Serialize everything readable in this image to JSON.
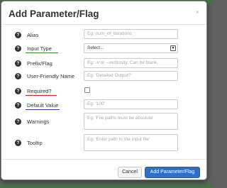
{
  "dialog": {
    "title": "Add Parameter/Flag",
    "close_glyph": "×",
    "help_glyph": "?",
    "fields": {
      "alias": {
        "label": "Alias",
        "placeholder": "Eg: num_of_iterations"
      },
      "input_type": {
        "label": "Input Type",
        "value": "Select...",
        "highlight_color": "#2e8b2e"
      },
      "prefix_flag": {
        "label": "Prefix/Flag",
        "placeholder": "Eg: -v or --verbosity. Can be blank."
      },
      "user_friendly_name": {
        "label": "User-Friendly Name",
        "placeholder": "Eg: 'Detailed Output?'"
      },
      "required": {
        "label": "Required?",
        "checked": false,
        "highlight_color": "#cc2222"
      },
      "default_value": {
        "label": "Default Value",
        "placeholder": "Eg: '100'",
        "highlight_color": "#3535b0"
      },
      "warnings": {
        "label": "Warnings",
        "placeholder": "Eg: 'File paths must be absolute'"
      },
      "tooltip": {
        "label": "Tooltip",
        "placeholder": "Eg: 'Enter path to the input file'"
      }
    },
    "footer": {
      "cancel_label": "Cancel",
      "submit_label": "Add Parameter/Flag"
    }
  },
  "colors": {
    "primary_button": "#2f6fc5",
    "backdrop": "#616161",
    "backdrop_accent": "#3e7a3e"
  },
  "icons": {
    "help": "question-circle-icon",
    "close": "close-icon",
    "dropdown": "chevron-down-icon"
  }
}
